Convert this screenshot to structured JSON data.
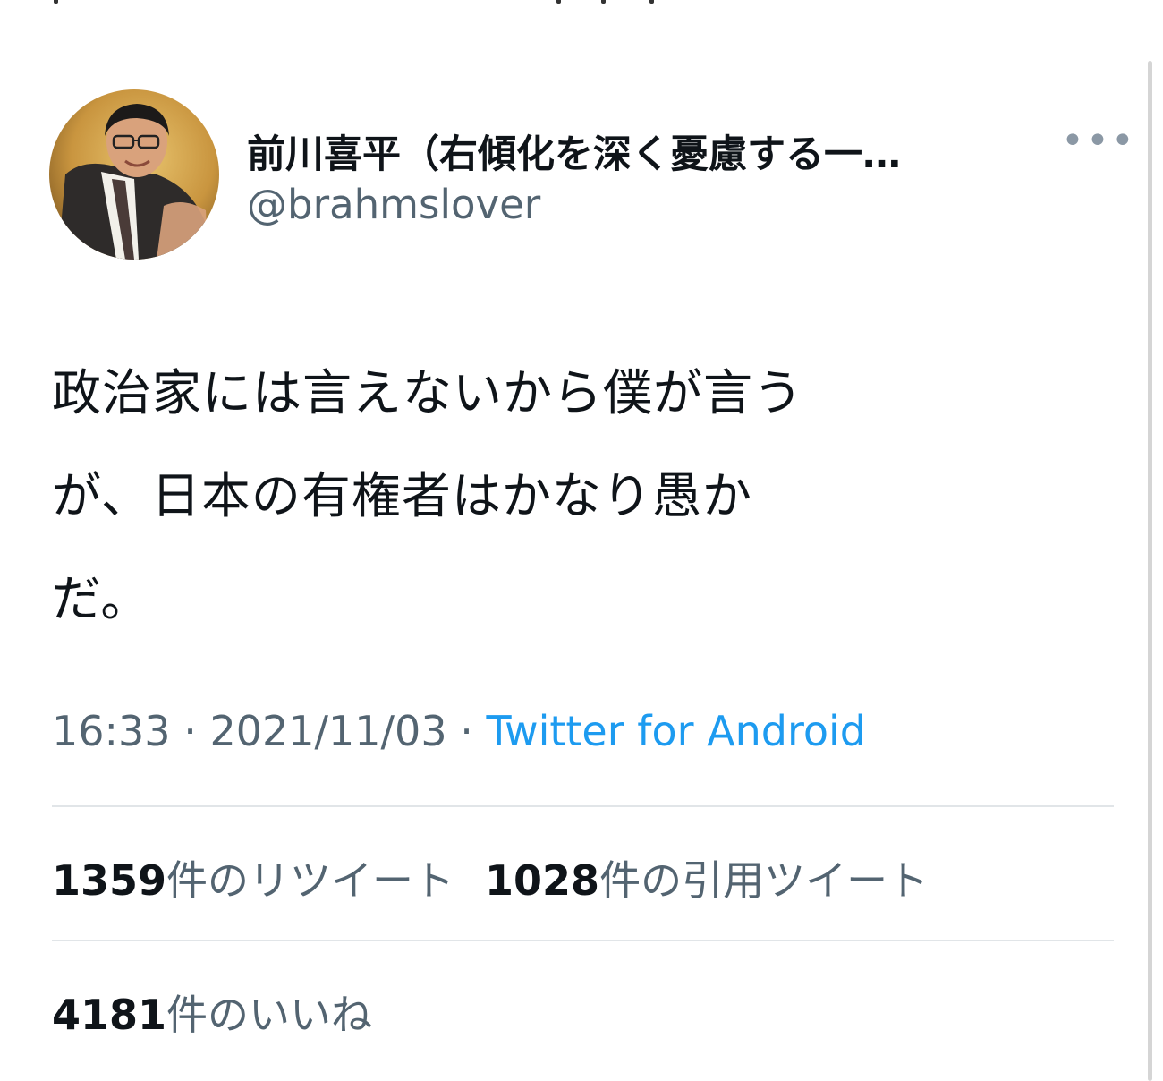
{
  "tweet": {
    "display_name": "前川喜平（右傾化を深く憂慮する一…",
    "handle": "@brahmslover",
    "more_icon": "more-horizontal-icon",
    "text_lines": [
      "政治家には言えないから僕が言う",
      "が、日本の有権者はかなり愚か",
      "だ。"
    ],
    "time": "16:33",
    "date": "2021/11/03",
    "separator": "·",
    "source": "Twitter for Android",
    "retweet_count": "1359",
    "retweet_label": "件のリツイート",
    "quote_count": "1028",
    "quote_label": "件の引用ツイート",
    "like_count": "4181",
    "like_label": "件のいいね"
  },
  "colors": {
    "link": "#1d9bf0",
    "secondary_text": "#536471",
    "primary_text": "#0f1419",
    "divider": "#e1e5e8"
  }
}
